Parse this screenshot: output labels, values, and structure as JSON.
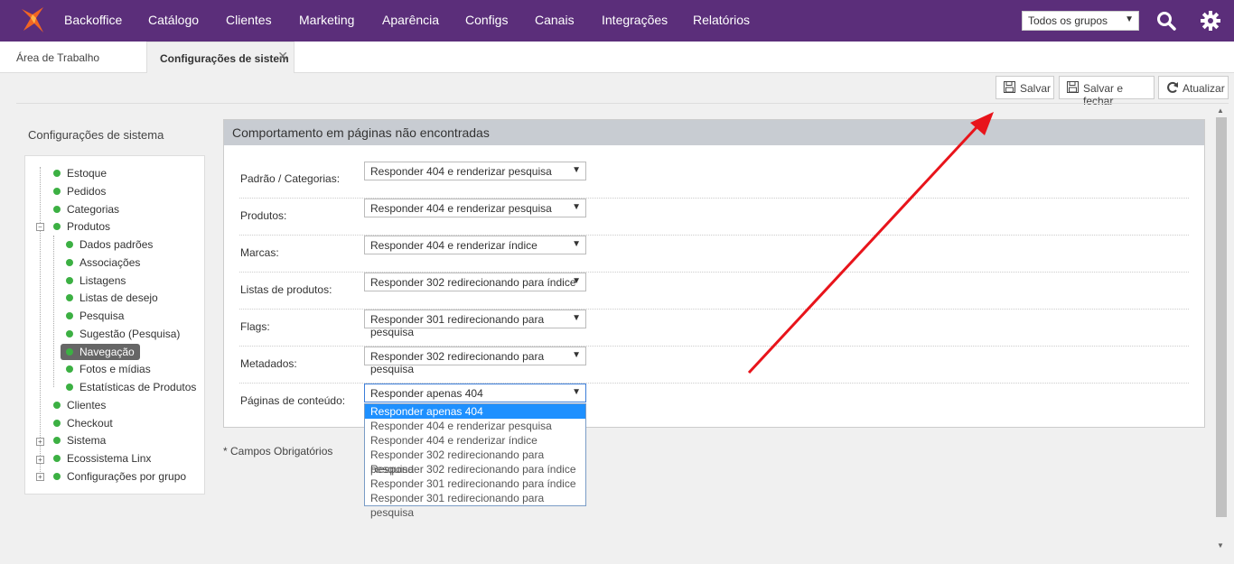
{
  "topbar": {
    "nav": [
      "Backoffice",
      "Catálogo",
      "Clientes",
      "Marketing",
      "Aparência",
      "Configs",
      "Canais",
      "Integrações",
      "Relatórios"
    ],
    "group_select": "Todos os grupos"
  },
  "tabs": {
    "first": "Área de Trabalho",
    "active": "Configurações de sistem"
  },
  "toolbar": {
    "save": "Salvar",
    "save_close": "Salvar e fechar",
    "refresh": "Atualizar"
  },
  "sidebar": {
    "title": "Configurações de sistema",
    "items": [
      "Estoque",
      "Pedidos",
      "Categorias",
      "Produtos",
      "Dados padrões",
      "Associações",
      "Listagens",
      "Listas de desejo",
      "Pesquisa",
      "Sugestão (Pesquisa)",
      "Navegação",
      "Fotos e mídias",
      "Estatísticas de Produtos",
      "Clientes",
      "Checkout",
      "Sistema",
      "Ecossistema Linx",
      "Configurações por grupo"
    ]
  },
  "panel": {
    "title": "Comportamento em páginas não encontradas",
    "rows": [
      {
        "label": "Padrão / Categorias:",
        "value": "Responder 404 e renderizar pesquisa"
      },
      {
        "label": "Produtos:",
        "value": "Responder 404 e renderizar pesquisa"
      },
      {
        "label": "Marcas:",
        "value": "Responder 404 e renderizar índice"
      },
      {
        "label": "Listas de produtos:",
        "value": "Responder 302 redirecionando para índice"
      },
      {
        "label": "Flags:",
        "value": "Responder 301 redirecionando para pesquisa"
      },
      {
        "label": "Metadados:",
        "value": "Responder 302 redirecionando para pesquisa"
      },
      {
        "label": "Páginas de conteúdo:",
        "value": "Responder apenas 404"
      }
    ],
    "dropdown_options": [
      "Responder apenas 404",
      "Responder 404 e renderizar pesquisa",
      "Responder 404 e renderizar índice",
      "Responder 302 redirecionando para pesquisa",
      "Responder 302 redirecionando para índice",
      "Responder 301 redirecionando para índice",
      "Responder 301 redirecionando para pesquisa"
    ]
  },
  "required_note": "* Campos Obrigatórios",
  "colors": {
    "topbar": "#5b2e7a",
    "status_dot": "#3cb043",
    "annotation_arrow": "#e8141b",
    "dropdown_highlight": "#1e90ff"
  }
}
